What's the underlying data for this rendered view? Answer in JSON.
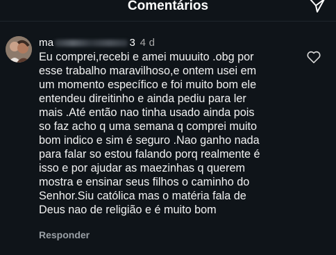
{
  "header": {
    "title": "Comentários"
  },
  "comment": {
    "username_visible_start": "ma",
    "username_visible_end": "3",
    "time": "4 d",
    "text": "Eu comprei,recebi e amei muuuito .obg por\nesse trabalho maravilhoso,e ontem usei em\num momento específico e foi muito bom ele\nentendeu direitinho e ainda pediu para ler\nmais .Até então nao tinha usado ainda pois\nso faz acho q uma semana q comprei muito\nbom indico e sim é seguro .Nao ganho nada\npara falar so estou falando porq realmente é\nisso e por ajudar as maezinhas q querem\nmostra e ensinar seus filhos o caminho do\nSenhor.Siu católica mas o matéria fala de\nDeus nao de religião e é muito bom",
    "reply_label": "Responder"
  },
  "colors": {
    "background": "#0f1419",
    "text": "#f2f2f2",
    "muted": "#9aa0a6"
  },
  "icons": {
    "send": "send-icon",
    "like": "heart-icon",
    "avatar": "avatar"
  }
}
